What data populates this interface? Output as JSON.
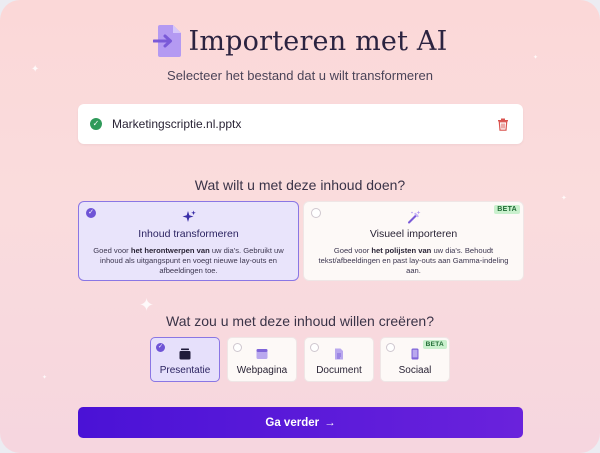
{
  "header": {
    "title": "Importeren met AI",
    "subtitle": "Selecteer het bestand dat u wilt transformeren"
  },
  "file": {
    "name": "Marketingscriptie.nl.pptx"
  },
  "content_question": "Wat wilt u met deze inhoud doen?",
  "content_options": [
    {
      "title": "Inhoud transformeren",
      "desc_pre": "Goed voor ",
      "desc_bold": "het herontwerpen van",
      "desc_post": " uw dia's. Gebruikt uw inhoud als uitgangspunt en voegt nieuwe lay-outs en afbeeldingen toe.",
      "selected": true
    },
    {
      "title": "Visueel importeren",
      "desc_pre": "Goed voor ",
      "desc_bold": "het polijsten van",
      "desc_post": " uw dia's. Behoudt tekst/afbeeldingen en past lay-outs aan Gamma-indeling aan.",
      "badge": "BETA",
      "selected": false
    }
  ],
  "format_question": "Wat zou u met deze inhoud willen creëren?",
  "formats": [
    {
      "label": "Presentatie",
      "selected": true
    },
    {
      "label": "Webpagina",
      "selected": false
    },
    {
      "label": "Document",
      "selected": false
    },
    {
      "label": "Sociaal",
      "selected": false,
      "badge": "BETA"
    }
  ],
  "continue_label": "Ga verder",
  "colors": {
    "accent": "#6f54d6",
    "button_start": "#4a12d6",
    "button_end": "#6a22dc",
    "success": "#2f9a5a",
    "danger": "#d9534f",
    "beta_bg": "#c9f0cd"
  },
  "icons": {
    "title": "file-import-icon",
    "file_status": "check-circle-icon",
    "file_remove": "trash-icon",
    "transform": "sparkles-icon",
    "visual_import": "magic-wand-icon",
    "presentation": "presentation-icon",
    "webpage": "browser-window-icon",
    "document": "document-icon",
    "social": "phone-icon",
    "continue": "arrow-right-icon"
  }
}
